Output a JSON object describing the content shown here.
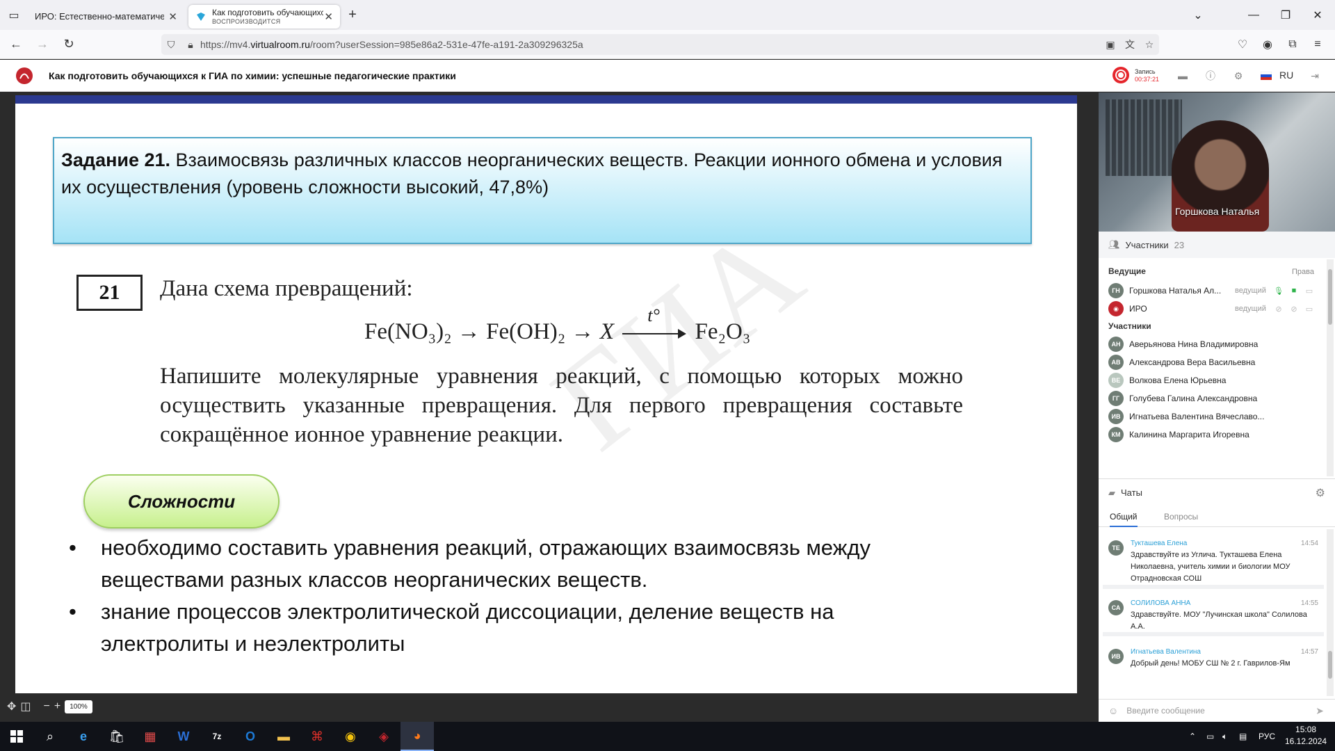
{
  "browser": {
    "tabs": [
      {
        "title": "ИРО: Естественно-математическ"
      },
      {
        "title": "Как подготовить обучающихс",
        "subtitle": "ВОСПРОИЗВОДИТСЯ"
      }
    ],
    "url_prefix": "https://mv4.",
    "url_host": "virtualroom.ru",
    "url_path": "/room?userSession=985e86a2-531e-47fe-a191-2a309296325a"
  },
  "app": {
    "title": "Как подготовить обучающихся к ГИА по химии: успешные педагогические практики",
    "record_label": "Запись",
    "record_time": "00:37:21",
    "lang": "RU"
  },
  "slide": {
    "task_bold": "Задание 21.",
    "task_text": " Взаимосвязь различных классов неорганических веществ. Реакции ионного обмена и условия их осуществления (уровень сложности высокий, 47,8%)",
    "task_number": "21",
    "given": "Дана схема превращений:",
    "scheme_part1": "Fe(NO₃)₂ → Fe(OH)₂ → ",
    "scheme_x": "X",
    "scheme_t": "t°",
    "scheme_end": "Fe₂O₃",
    "instruction": "Напишите молекулярные уравнения реакций, с помощью которых можно осуществить указанные превращения. Для первого превращения составьте сокращённое ионное уравнение реакции.",
    "watermark": "ГИА",
    "difficulties_label": "Сложности",
    "bullets": [
      "необходимо составить уравнения реакций, отражающих взаимосвязь между веществами разных классов неорганических веществ.",
      "знание процессов электролитической диссоциации, деление веществ на электролиты и неэлектролиты"
    ],
    "zoom": "100%"
  },
  "video": {
    "speaker": "Горшкова Наталья"
  },
  "participants": {
    "header": "Участники",
    "count": "23",
    "hosts_label": "Ведущие",
    "rights_label": "Права",
    "hosts": [
      {
        "initials": "ГН",
        "name": "Горшкова Наталья Ал...",
        "role": "ведущий"
      },
      {
        "initials": "",
        "name": "ИРО",
        "role": "ведущий"
      }
    ],
    "members_label": "Участники",
    "members": [
      {
        "initials": "АН",
        "name": "Аверьянова Нина Владимировна"
      },
      {
        "initials": "АВ",
        "name": "Александрова Вера Васильевна"
      },
      {
        "initials": "ВЕ",
        "name": "Волкова Елена Юрьевна"
      },
      {
        "initials": "ГГ",
        "name": "Голубева Галина Александровна"
      },
      {
        "initials": "ИВ",
        "name": "Игнатьева Валентина Вячеславо..."
      },
      {
        "initials": "КМ",
        "name": "Калинина Маргарита Игоревна"
      }
    ]
  },
  "chats": {
    "header": "Чаты",
    "tabs": [
      "Общий",
      "Вопросы"
    ],
    "messages": [
      {
        "initials": "ТЕ",
        "author": "Тукташева Елена",
        "time": "14:54",
        "text": "Здравствуйте из Углича. Тукташева Елена Николаевна, учитель химии и биологии МОУ Отрадновская СОШ"
      },
      {
        "initials": "СА",
        "author": "СОЛИЛОВА АННА",
        "time": "14:55",
        "text": "Здравствуйте. МОУ \"Лучинская школа\" Солилова А.А."
      },
      {
        "initials": "ИВ",
        "author": "Игнатьева Валентина",
        "time": "14:57",
        "text": "Добрый день! МОБУ СШ № 2 г. Гаврилов-Ям"
      }
    ],
    "input_placeholder": "Введите сообщение"
  },
  "taskbar": {
    "lang": "РУС",
    "time": "15:08",
    "date": "16.12.2024"
  },
  "colors": {
    "slide_topbar": "#2b3990",
    "record": "#e5262c",
    "chat_author": "#2a9fd6"
  }
}
